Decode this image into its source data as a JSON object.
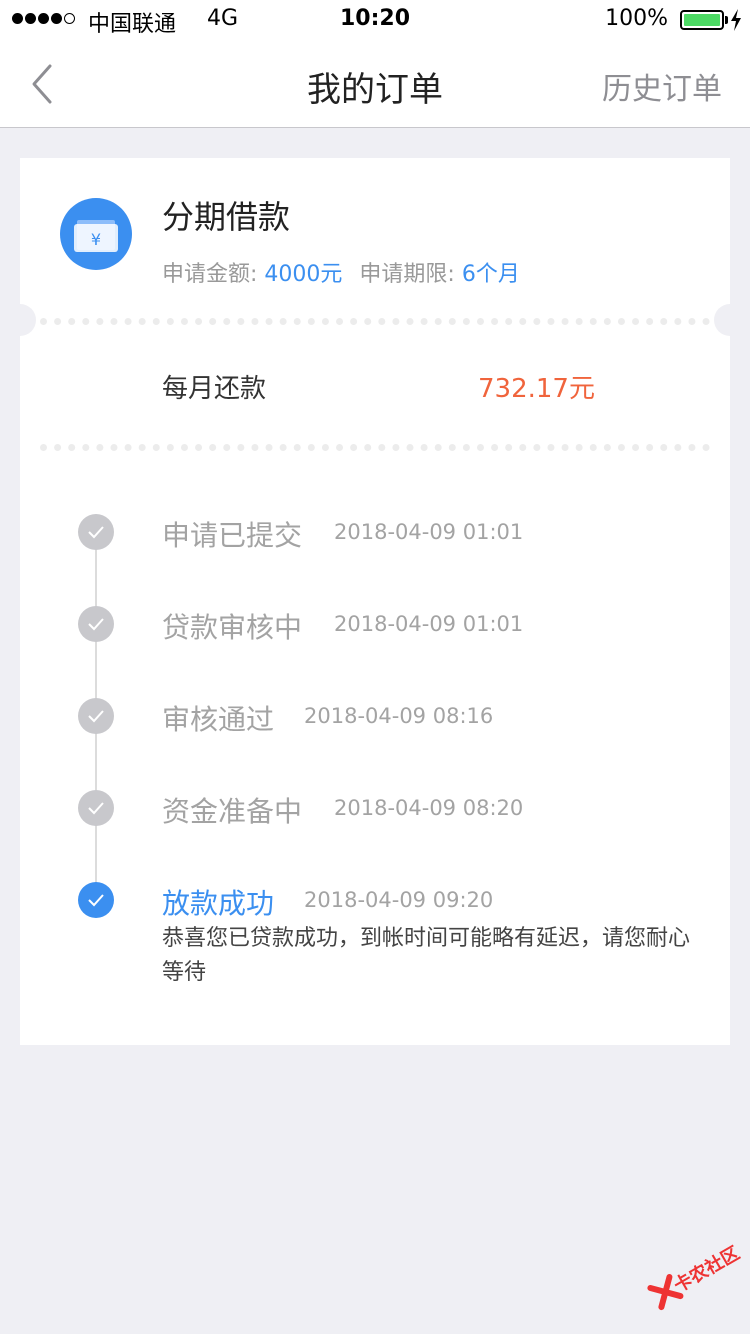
{
  "status_bar": {
    "carrier": "中国联通",
    "network": "4G",
    "time": "10:20",
    "battery": "100%"
  },
  "nav": {
    "back_icon": "chevron-left-icon",
    "title": "我的订单",
    "history_label": "历史订单"
  },
  "loan": {
    "icon": "wallet-yen-icon",
    "icon_glyph": "¥",
    "title": "分期借款",
    "amount_label": "申请金额:",
    "amount_value": "4000元",
    "term_label": "申请期限:",
    "term_value": "6个月"
  },
  "monthly": {
    "label": "每月还款",
    "value": "732.17元"
  },
  "timeline": [
    {
      "title": "申请已提交",
      "time": "2018-04-09 01:01",
      "active": false
    },
    {
      "title": "贷款审核中",
      "time": "2018-04-09 01:01",
      "active": false
    },
    {
      "title": "审核通过",
      "time": "2018-04-09 08:16",
      "active": false
    },
    {
      "title": "资金准备中",
      "time": "2018-04-09 08:20",
      "active": false
    },
    {
      "title": "放款成功",
      "time": "2018-04-09 09:20",
      "active": true,
      "note": "恭喜您已贷款成功，到帐时间可能略有延迟，请您耐心等待"
    }
  ],
  "watermark": {
    "text": "卡农社区"
  },
  "colors": {
    "accent": "#3b8ff0",
    "amount": "#f0643c",
    "battery": "#4cd964",
    "background": "#efeff4"
  }
}
